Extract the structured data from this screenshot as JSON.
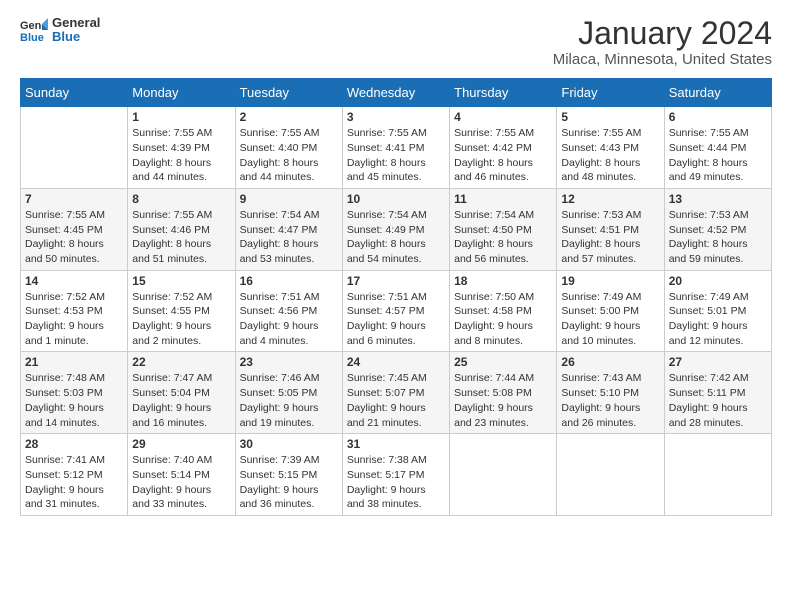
{
  "header": {
    "logo_line1": "General",
    "logo_line2": "Blue",
    "title": "January 2024",
    "subtitle": "Milaca, Minnesota, United States"
  },
  "days_of_week": [
    "Sunday",
    "Monday",
    "Tuesday",
    "Wednesday",
    "Thursday",
    "Friday",
    "Saturday"
  ],
  "weeks": [
    [
      {
        "day": "",
        "info": ""
      },
      {
        "day": "1",
        "info": "Sunrise: 7:55 AM\nSunset: 4:39 PM\nDaylight: 8 hours and 44 minutes."
      },
      {
        "day": "2",
        "info": "Sunrise: 7:55 AM\nSunset: 4:40 PM\nDaylight: 8 hours and 44 minutes."
      },
      {
        "day": "3",
        "info": "Sunrise: 7:55 AM\nSunset: 4:41 PM\nDaylight: 8 hours and 45 minutes."
      },
      {
        "day": "4",
        "info": "Sunrise: 7:55 AM\nSunset: 4:42 PM\nDaylight: 8 hours and 46 minutes."
      },
      {
        "day": "5",
        "info": "Sunrise: 7:55 AM\nSunset: 4:43 PM\nDaylight: 8 hours and 48 minutes."
      },
      {
        "day": "6",
        "info": "Sunrise: 7:55 AM\nSunset: 4:44 PM\nDaylight: 8 hours and 49 minutes."
      }
    ],
    [
      {
        "day": "7",
        "info": "Sunrise: 7:55 AM\nSunset: 4:45 PM\nDaylight: 8 hours and 50 minutes."
      },
      {
        "day": "8",
        "info": "Sunrise: 7:55 AM\nSunset: 4:46 PM\nDaylight: 8 hours and 51 minutes."
      },
      {
        "day": "9",
        "info": "Sunrise: 7:54 AM\nSunset: 4:47 PM\nDaylight: 8 hours and 53 minutes."
      },
      {
        "day": "10",
        "info": "Sunrise: 7:54 AM\nSunset: 4:49 PM\nDaylight: 8 hours and 54 minutes."
      },
      {
        "day": "11",
        "info": "Sunrise: 7:54 AM\nSunset: 4:50 PM\nDaylight: 8 hours and 56 minutes."
      },
      {
        "day": "12",
        "info": "Sunrise: 7:53 AM\nSunset: 4:51 PM\nDaylight: 8 hours and 57 minutes."
      },
      {
        "day": "13",
        "info": "Sunrise: 7:53 AM\nSunset: 4:52 PM\nDaylight: 8 hours and 59 minutes."
      }
    ],
    [
      {
        "day": "14",
        "info": "Sunrise: 7:52 AM\nSunset: 4:53 PM\nDaylight: 9 hours and 1 minute."
      },
      {
        "day": "15",
        "info": "Sunrise: 7:52 AM\nSunset: 4:55 PM\nDaylight: 9 hours and 2 minutes."
      },
      {
        "day": "16",
        "info": "Sunrise: 7:51 AM\nSunset: 4:56 PM\nDaylight: 9 hours and 4 minutes."
      },
      {
        "day": "17",
        "info": "Sunrise: 7:51 AM\nSunset: 4:57 PM\nDaylight: 9 hours and 6 minutes."
      },
      {
        "day": "18",
        "info": "Sunrise: 7:50 AM\nSunset: 4:58 PM\nDaylight: 9 hours and 8 minutes."
      },
      {
        "day": "19",
        "info": "Sunrise: 7:49 AM\nSunset: 5:00 PM\nDaylight: 9 hours and 10 minutes."
      },
      {
        "day": "20",
        "info": "Sunrise: 7:49 AM\nSunset: 5:01 PM\nDaylight: 9 hours and 12 minutes."
      }
    ],
    [
      {
        "day": "21",
        "info": "Sunrise: 7:48 AM\nSunset: 5:03 PM\nDaylight: 9 hours and 14 minutes."
      },
      {
        "day": "22",
        "info": "Sunrise: 7:47 AM\nSunset: 5:04 PM\nDaylight: 9 hours and 16 minutes."
      },
      {
        "day": "23",
        "info": "Sunrise: 7:46 AM\nSunset: 5:05 PM\nDaylight: 9 hours and 19 minutes."
      },
      {
        "day": "24",
        "info": "Sunrise: 7:45 AM\nSunset: 5:07 PM\nDaylight: 9 hours and 21 minutes."
      },
      {
        "day": "25",
        "info": "Sunrise: 7:44 AM\nSunset: 5:08 PM\nDaylight: 9 hours and 23 minutes."
      },
      {
        "day": "26",
        "info": "Sunrise: 7:43 AM\nSunset: 5:10 PM\nDaylight: 9 hours and 26 minutes."
      },
      {
        "day": "27",
        "info": "Sunrise: 7:42 AM\nSunset: 5:11 PM\nDaylight: 9 hours and 28 minutes."
      }
    ],
    [
      {
        "day": "28",
        "info": "Sunrise: 7:41 AM\nSunset: 5:12 PM\nDaylight: 9 hours and 31 minutes."
      },
      {
        "day": "29",
        "info": "Sunrise: 7:40 AM\nSunset: 5:14 PM\nDaylight: 9 hours and 33 minutes."
      },
      {
        "day": "30",
        "info": "Sunrise: 7:39 AM\nSunset: 5:15 PM\nDaylight: 9 hours and 36 minutes."
      },
      {
        "day": "31",
        "info": "Sunrise: 7:38 AM\nSunset: 5:17 PM\nDaylight: 9 hours and 38 minutes."
      },
      {
        "day": "",
        "info": ""
      },
      {
        "day": "",
        "info": ""
      },
      {
        "day": "",
        "info": ""
      }
    ]
  ]
}
